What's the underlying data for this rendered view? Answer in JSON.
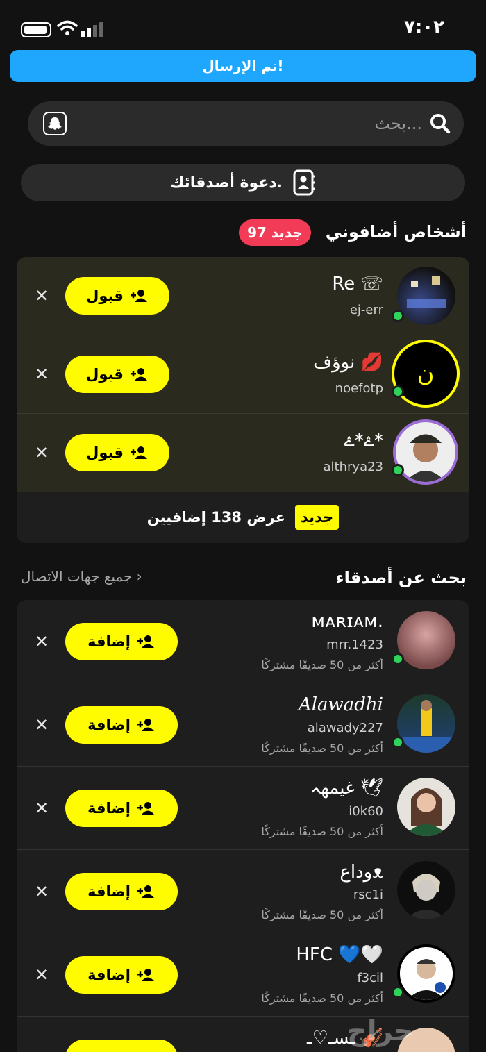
{
  "status": {
    "time": "٧:٠٢"
  },
  "toast": {
    "text": "تم الإرسال!"
  },
  "search": {
    "placeholder": "بحث..."
  },
  "invite": {
    "label": "دعوة أصدقائك."
  },
  "requests": {
    "title": "أشخاص أضافوني",
    "badge": "97 جديد",
    "accept_label": "قبول",
    "items": [
      {
        "name": "Re ☏",
        "username": "ej-err"
      },
      {
        "name": "نوؤف 💋",
        "username": "noefotp",
        "avatar_letter": "ن"
      },
      {
        "name": "ےٛ*ےٛ*",
        "username": "althrya23"
      }
    ],
    "more": {
      "tag": "جديد",
      "text": "عرض 138 إضافيين"
    }
  },
  "suggestions": {
    "title": "بحث عن أصدقاء",
    "all_contacts": "جميع جهات الاتصال ›",
    "add_label": "إضافة",
    "mutual_text": "أكثر من 50 صديقًا مشتركًا",
    "items": [
      {
        "name": "ᴍᴀʀɪᴀᴍ.",
        "username": "mrr.1423"
      },
      {
        "name": "Alawadhi",
        "username": "alawady227"
      },
      {
        "name": "غيمهہ 🕊",
        "username": "i0k60"
      },
      {
        "name": "وداعᴥ",
        "username": "rsc1i"
      },
      {
        "name": "HFC 💙🤍",
        "username": "f3cil"
      },
      {
        "name": "ـسـ♡ـ 🎻",
        "username": ""
      }
    ]
  },
  "watermark": "حراج"
}
